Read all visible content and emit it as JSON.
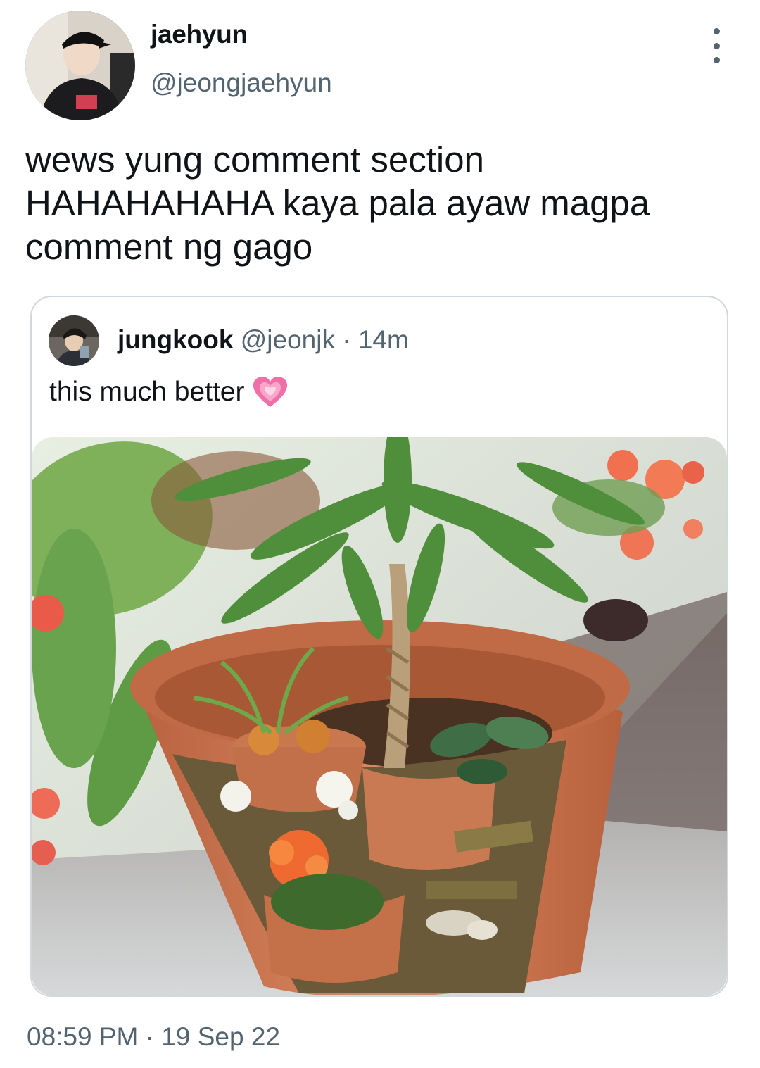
{
  "author": {
    "display_name": "jaehyun",
    "handle": "@jeongjaehyun"
  },
  "tweet": {
    "text": "wews yung comment section HAHAHAHAHA kaya pala ayaw magpa comment ng gago",
    "time": "08:59 PM",
    "separator": " · ",
    "date": "19 Sep 22"
  },
  "quoted_tweet": {
    "display_name": "jungkook",
    "handle": "@jeonjk",
    "separator": " · ",
    "age": "14m",
    "text": "this much better",
    "emoji_icon": "growing-heart-icon",
    "media_icon": "broken-pot-fairy-garden-photo"
  },
  "colors": {
    "text_primary": "#0f1419",
    "text_secondary": "#536471",
    "border": "#cfd9de"
  }
}
